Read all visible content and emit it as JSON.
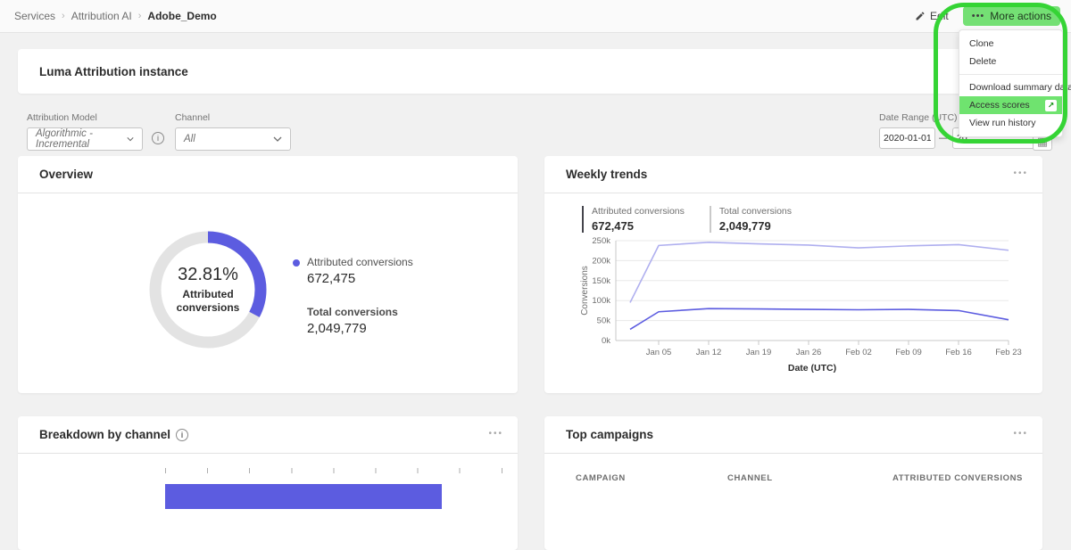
{
  "colors": {
    "accent_purple": "#5C5CE0",
    "light_series_purple": "#AFAFEF",
    "annotation_green": "#35D435",
    "button_highlight_green": "#74E074",
    "menu_highlight_green": "#6FE36F",
    "legend_bar_dark": "#44444C",
    "legend_bar_gray": "#C9C9C9"
  },
  "breadcrumb": {
    "separator": "›",
    "items": [
      {
        "label": "Services"
      },
      {
        "label": "Attribution AI"
      },
      {
        "label": "Adobe_Demo"
      }
    ]
  },
  "topbar": {
    "edit_label": "Edit",
    "more_actions_label": "More actions",
    "more_actions_icon": "•••"
  },
  "more_actions_menu": {
    "items": [
      {
        "label": "Clone"
      },
      {
        "label": "Delete"
      },
      {
        "label": "Download summary data"
      },
      {
        "label": "Access scores",
        "highlighted": true
      },
      {
        "label": "View run history"
      }
    ]
  },
  "instance_header": {
    "title": "Luma Attribution instance"
  },
  "filters": {
    "attribution_model": {
      "label": "Attribution Model",
      "value": "Algorithmic - Incremental"
    },
    "channel": {
      "label": "Channel",
      "value": "All"
    },
    "date_range": {
      "label": "Date Range (UTC)",
      "start_value": "2020-01-01",
      "separator": "—",
      "end_value_visible": "20",
      "calendar_icon": "▦"
    }
  },
  "overview": {
    "title": "Overview",
    "donut": {
      "percent": 32.81,
      "percent_label": "32.81%",
      "center_label": "Attributed conversions"
    },
    "legend": [
      {
        "label": "Attributed conversions",
        "value": "672,475"
      },
      {
        "label": "Total conversions",
        "value": "2,049,779"
      }
    ]
  },
  "weekly_trends": {
    "title": "Weekly trends",
    "menu_icon": "•••",
    "legend": [
      {
        "label": "Attributed conversions",
        "value": "672,475"
      },
      {
        "label": "Total conversions",
        "value": "2,049,779"
      }
    ],
    "chart_data": {
      "type": "line",
      "title": "Weekly trends",
      "xlabel": "Date (UTC)",
      "ylabel": "Conversions",
      "ylim": [
        0,
        250
      ],
      "y_ticks": [
        0,
        50,
        100,
        150,
        200,
        250
      ],
      "y_tick_labels": [
        "0k",
        "50k",
        "100k",
        "150k",
        "200k",
        "250k"
      ],
      "x_tick_days": [
        4,
        11,
        18,
        25,
        32,
        39,
        46,
        53
      ],
      "x_tick_labels": [
        "Jan 05",
        "Jan 12",
        "Jan 19",
        "Jan 26",
        "Feb 02",
        "Feb 09",
        "Feb 16",
        "Feb 23"
      ],
      "x_days": [
        0,
        4,
        11,
        18,
        25,
        32,
        39,
        46,
        53
      ],
      "grid": true,
      "legend_position": "top-left",
      "series": [
        {
          "name": "Total conversions",
          "color": "#AFAFEF",
          "values_k": [
            95,
            238,
            246,
            242,
            239,
            232,
            237,
            240,
            226
          ]
        },
        {
          "name": "Attributed conversions",
          "color": "#5C5CE0",
          "values_k": [
            28,
            72,
            80,
            79,
            78,
            77,
            78,
            75,
            52
          ]
        }
      ]
    }
  },
  "breakdown": {
    "title": "Breakdown by channel",
    "menu_icon": "•••",
    "chart_data": {
      "type": "bar",
      "orientation": "horizontal",
      "bar_color": "#5C5CE0",
      "axis_tick_count": 9
    }
  },
  "top_campaigns": {
    "title": "Top campaigns",
    "menu_icon": "•••",
    "columns": [
      "CAMPAIGN",
      "CHANNEL",
      "ATTRIBUTED CONVERSIONS"
    ]
  }
}
